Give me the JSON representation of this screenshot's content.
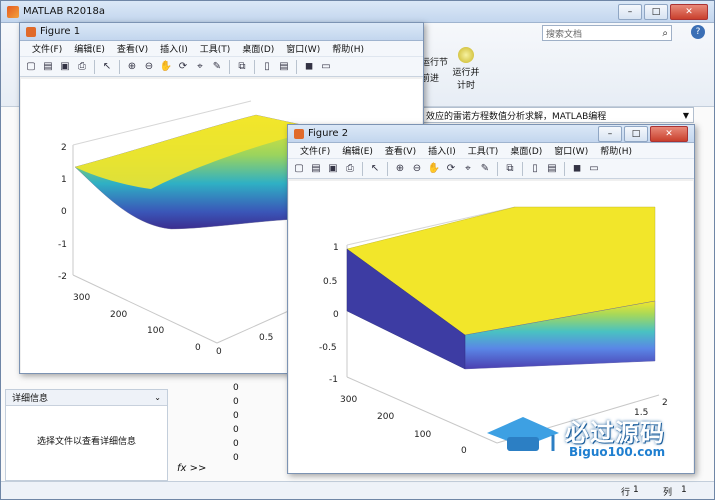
{
  "main_window": {
    "title": "MATLAB R2018a",
    "search_placeholder": "搜索文档",
    "toolstrip": {
      "run_section_label": "运行节",
      "advance_label": "前进",
      "run_and_time_label": "运行并\n计时"
    },
    "address_text": "效应的雷诺方程数值分析求解，MATLAB编程",
    "details_panel": {
      "title": "详细信息",
      "empty_text": "选择文件以查看详细信息"
    },
    "workspace_values": [
      "0",
      "0",
      "0",
      "0",
      "0",
      "0"
    ],
    "command_prompt": "fx >>",
    "statusbar": {
      "row_label": "行",
      "row_value": "1",
      "col_label": "列",
      "col_value": "1"
    }
  },
  "menus": [
    "文件(F)",
    "编辑(E)",
    "查看(V)",
    "插入(I)",
    "工具(T)",
    "桌面(D)",
    "窗口(W)",
    "帮助(H)"
  ],
  "figure1": {
    "title": "Figure 1",
    "z_ticks": [
      "2",
      "1",
      "0",
      "-1",
      "-2"
    ],
    "y_ticks": [
      "300",
      "200",
      "100",
      "0"
    ],
    "x_ticks": [
      "0",
      "0.5"
    ]
  },
  "figure2": {
    "title": "Figure 2",
    "z_ticks": [
      "1",
      "0.5",
      "0",
      "-0.5",
      "-1"
    ],
    "y_ticks": [
      "300",
      "200",
      "100",
      "0"
    ],
    "x_ticks": [
      "2",
      "1.5"
    ]
  },
  "watermark": {
    "brand": "必过源码",
    "url": "Biguo100.com"
  },
  "colors": {
    "surface_top": "#f2e62a",
    "surface_side": "#3b3fa0",
    "accent": "#3da0e3"
  }
}
